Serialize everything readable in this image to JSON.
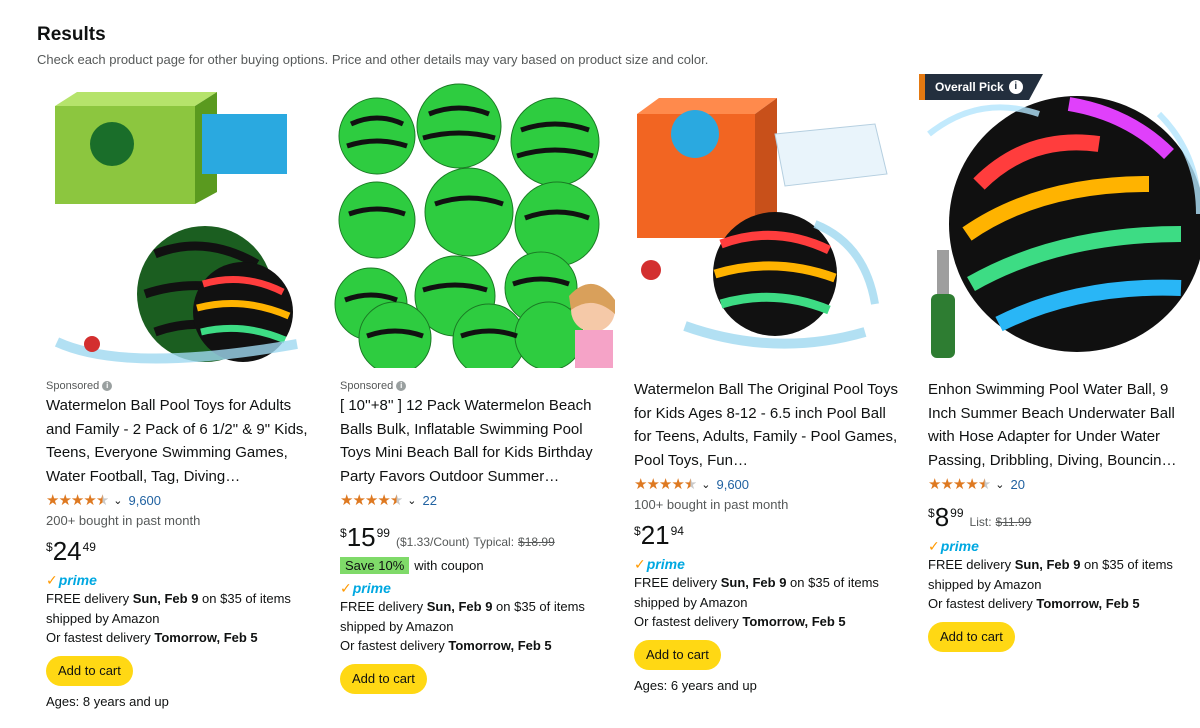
{
  "header": {
    "title": "Results",
    "subtitle": "Check each product page for other buying options. Price and other details may vary based on product size and color."
  },
  "colors": {
    "star": "#de7921",
    "prime": "#00a8e1",
    "cart_button": "#ffd814",
    "link": "#2162a1",
    "badge": "#232f3e",
    "badge_accent": "#e47911",
    "coupon": "#7fda69"
  },
  "cards": [
    {
      "sponsored": "Sponsored",
      "title": "Watermelon Ball Pool Toys for Adults and Family - 2 Pack of 6 1/2\" & 9\" Kids, Teens, Everyone Swimming Games, Water Football, Tag, Diving…",
      "rating": 4.5,
      "rating_count": "9,600",
      "bought": "200+ bought in past month",
      "price": {
        "currency": "$",
        "whole": "24",
        "fraction": "49"
      },
      "prime": "prime",
      "delivery_prefix": "FREE delivery ",
      "delivery_date": "Sun, Feb 9",
      "delivery_suffix": " on $35 of items shipped by Amazon",
      "fastest_prefix": "Or fastest delivery ",
      "fastest_date": "Tomorrow, Feb 5",
      "cart": "Add to cart",
      "ages": "Ages: 8 years and up",
      "image_icon": "watermelon-ball-box-image"
    },
    {
      "sponsored": "Sponsored",
      "title": "[ 10''+8'' ] 12 Pack Watermelon Beach Balls Bulk, Inflatable Swimming Pool Toys Mini Beach Ball for Kids Birthday Party Favors Outdoor Summer…",
      "rating": 4.5,
      "rating_count": "22",
      "price": {
        "currency": "$",
        "whole": "15",
        "fraction": "99"
      },
      "unit_price": "($1.33/Count)",
      "typical_label": "Typical:",
      "typical_price": "$18.99",
      "coupon_badge": "Save 10%",
      "coupon_text": "with coupon",
      "prime": "prime",
      "delivery_prefix": "FREE delivery ",
      "delivery_date": "Sun, Feb 9",
      "delivery_suffix": " on $35 of items shipped by Amazon",
      "fastest_prefix": "Or fastest delivery ",
      "fastest_date": "Tomorrow, Feb 5",
      "cart": "Add to cart",
      "image_icon": "watermelon-beach-balls-image"
    },
    {
      "title": "Watermelon Ball The Original Pool Toys for Kids Ages 8-12 - 6.5 inch Pool Ball for Teens, Adults, Family - Pool Games, Pool Toys, Fun…",
      "rating": 4.5,
      "rating_count": "9,600",
      "bought": "100+ bought in past month",
      "price": {
        "currency": "$",
        "whole": "21",
        "fraction": "94"
      },
      "prime": "prime",
      "delivery_prefix": "FREE delivery ",
      "delivery_date": "Sun, Feb 9",
      "delivery_suffix": " on $35 of items shipped by Amazon",
      "fastest_prefix": "Or fastest delivery ",
      "fastest_date": "Tomorrow, Feb 5",
      "cart": "Add to cart",
      "ages": "Ages: 6 years and up",
      "image_icon": "watermelon-ball-jr-image"
    },
    {
      "badge": "Overall Pick",
      "title": "Enhon Swimming Pool Water Ball, 9 Inch Summer Beach Underwater Ball with Hose Adapter for Under Water Passing, Dribbling, Diving, Bouncin…",
      "rating": 4.5,
      "rating_count": "20",
      "price": {
        "currency": "$",
        "whole": "8",
        "fraction": "99"
      },
      "list_label": "List:",
      "list_price": "$11.99",
      "prime": "prime",
      "delivery_prefix": "FREE delivery ",
      "delivery_date": "Sun, Feb 9",
      "delivery_suffix": " on $35 of items shipped by Amazon",
      "fastest_prefix": "Or fastest delivery ",
      "fastest_date": "Tomorrow, Feb 5",
      "cart": "Add to cart",
      "image_icon": "rainbow-water-ball-image"
    }
  ]
}
